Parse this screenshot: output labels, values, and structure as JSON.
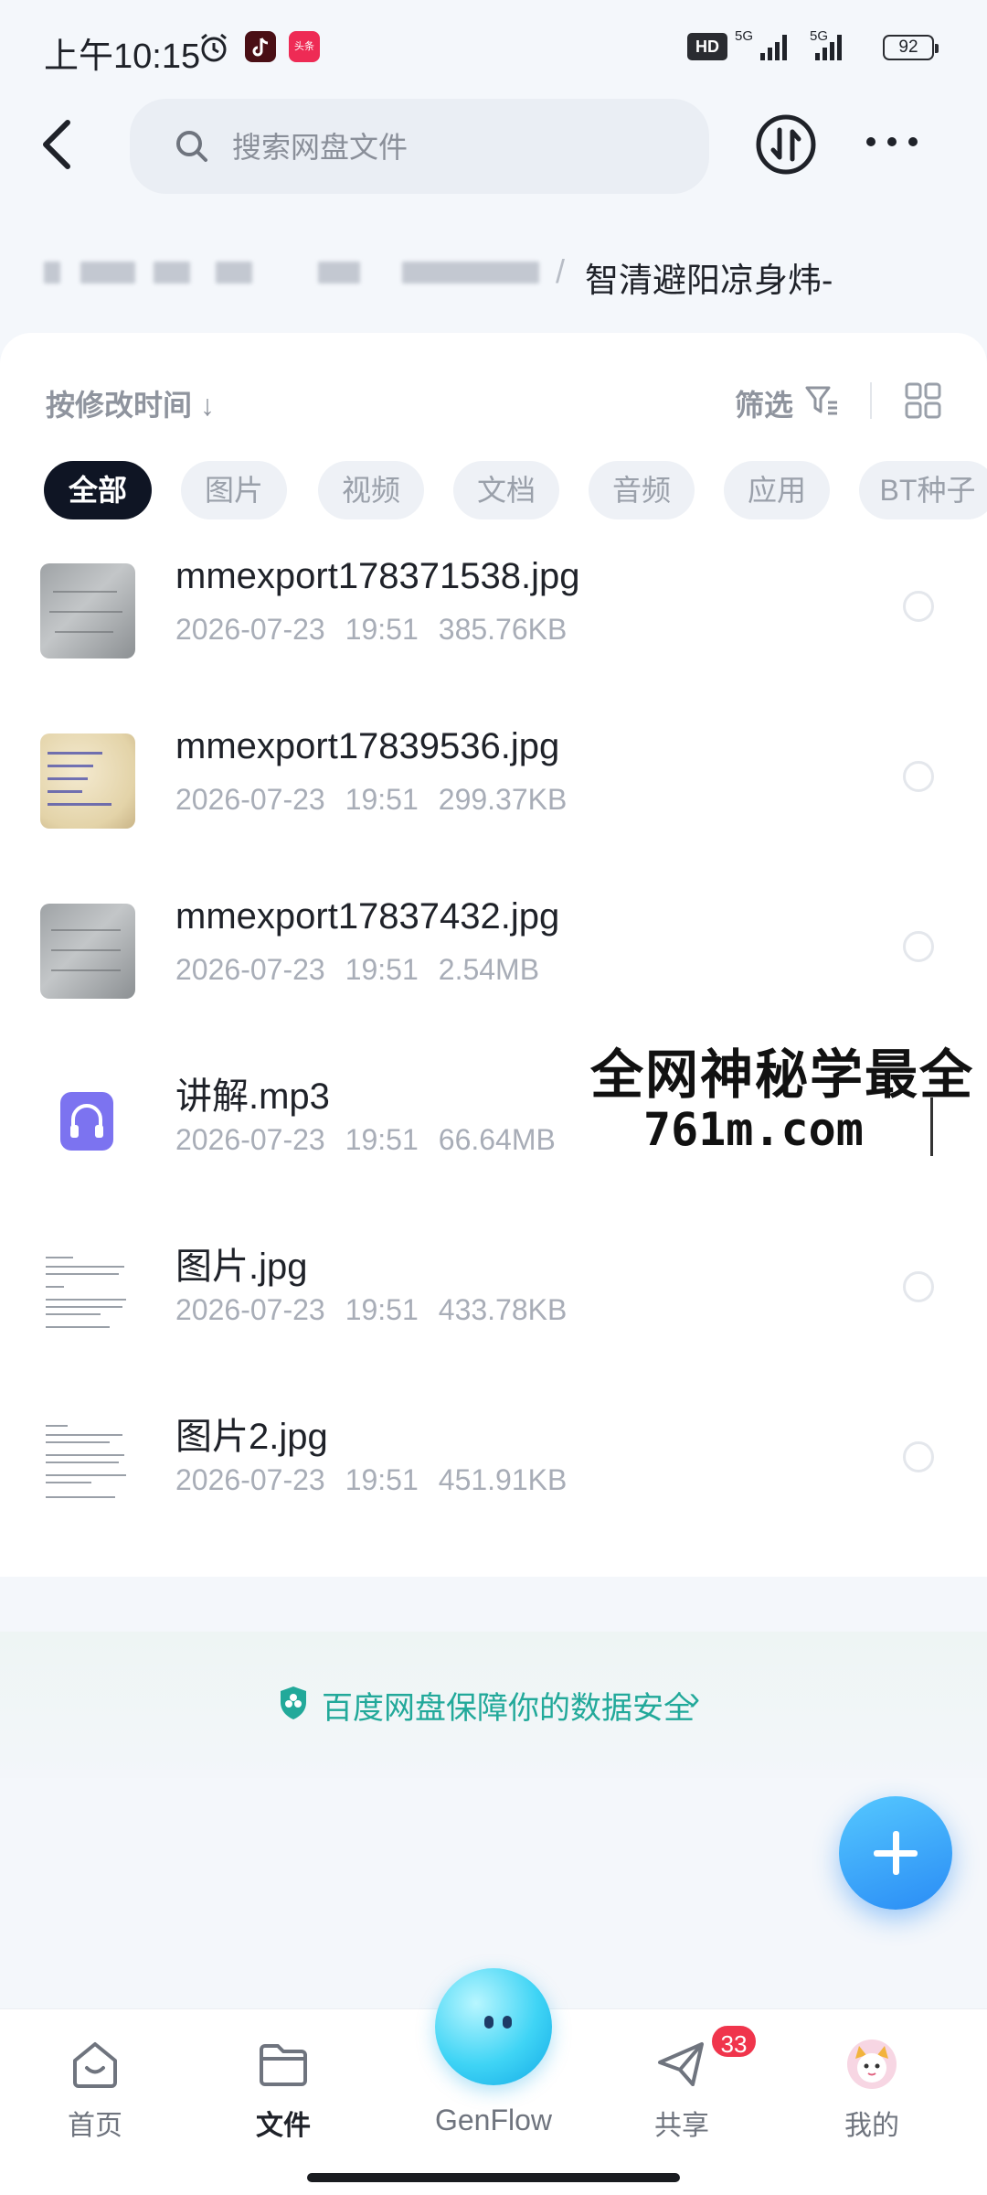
{
  "status_bar": {
    "time": "上午10:15",
    "app2_label": "头条",
    "hd_label": "HD",
    "network1": "5G",
    "network2": "5G",
    "battery": "92"
  },
  "header": {
    "search_placeholder": "搜索网盘文件"
  },
  "breadcrumb": {
    "separator": "/",
    "current": "智清避阳凉身炜-"
  },
  "toolbar": {
    "sort_label": "按修改时间 ↓",
    "filter_label": "筛选"
  },
  "chips": [
    {
      "label": "全部",
      "active": true
    },
    {
      "label": "图片",
      "active": false
    },
    {
      "label": "视频",
      "active": false
    },
    {
      "label": "文档",
      "active": false
    },
    {
      "label": "音频",
      "active": false
    },
    {
      "label": "应用",
      "active": false
    },
    {
      "label": "BT种子",
      "active": false
    }
  ],
  "files": [
    {
      "name": "mmexport178371538.jpg",
      "date": "2026-07-23",
      "time": "19:51",
      "size": "385.76KB",
      "thumb": "image-gray"
    },
    {
      "name": "mmexport17839536.jpg",
      "date": "2026-07-23",
      "time": "19:51",
      "size": "299.37KB",
      "thumb": "image-paper"
    },
    {
      "name": "mmexport17837432.jpg",
      "date": "2026-07-23",
      "time": "19:51",
      "size": "2.54MB",
      "thumb": "image-gray"
    },
    {
      "name": "讲解.mp3",
      "date": "2026-07-23",
      "time": "19:51",
      "size": "66.64MB",
      "thumb": "audio-icon"
    },
    {
      "name": "图片.jpg",
      "date": "2026-07-23",
      "time": "19:51",
      "size": "433.78KB",
      "thumb": "image-doc"
    },
    {
      "name": "图片2.jpg",
      "date": "2026-07-23",
      "time": "19:51",
      "size": "451.91KB",
      "thumb": "image-doc"
    }
  ],
  "watermark": {
    "line1": "全网神秘学最全",
    "line2": "761m.com"
  },
  "security_notice": {
    "text": "百度网盘保障你的数据安全",
    "arrow": "›"
  },
  "bottom_nav": {
    "home": "首页",
    "files": "文件",
    "genflow": "GenFlow",
    "share": "共享",
    "share_badge": "33",
    "mine": "我的"
  },
  "colors": {
    "accent_teal": "#22a99a",
    "fab_blue": "#2a8cf5",
    "chip_active_bg": "#0f1524",
    "badge_red": "#f0354c"
  }
}
